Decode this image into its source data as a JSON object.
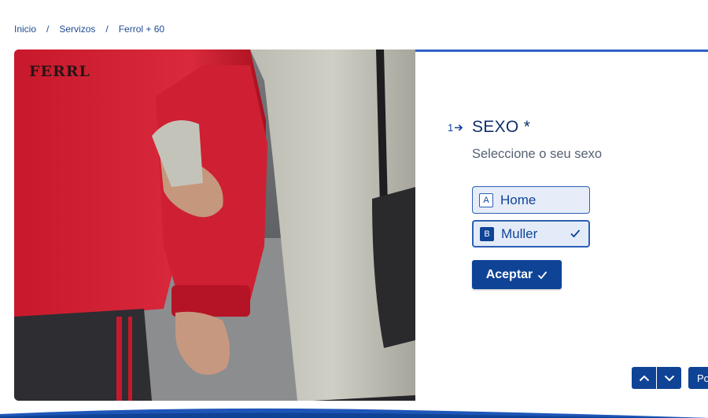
{
  "breadcrumb": {
    "items": [
      "Inicio",
      "Servizos",
      "Ferrol + 60"
    ],
    "separator": "/"
  },
  "logo": {
    "text": "FERRL"
  },
  "question": {
    "number": "1",
    "arrow_icon": "arrow-right-icon",
    "title": "SEXO *",
    "description": "Seleccione o seu sexo",
    "options": [
      {
        "key": "A",
        "label": "Home",
        "selected": false
      },
      {
        "key": "B",
        "label": "Muller",
        "selected": true
      }
    ],
    "ok_label": "Aceptar"
  },
  "navigation": {
    "up_icon": "chevron-up-icon",
    "down_icon": "chevron-down-icon",
    "powered_label": "Po"
  },
  "colors": {
    "accent": "#0f4396",
    "option_bg": "#e6edf8",
    "title": "#0f2f6b",
    "text_muted": "#556173"
  }
}
